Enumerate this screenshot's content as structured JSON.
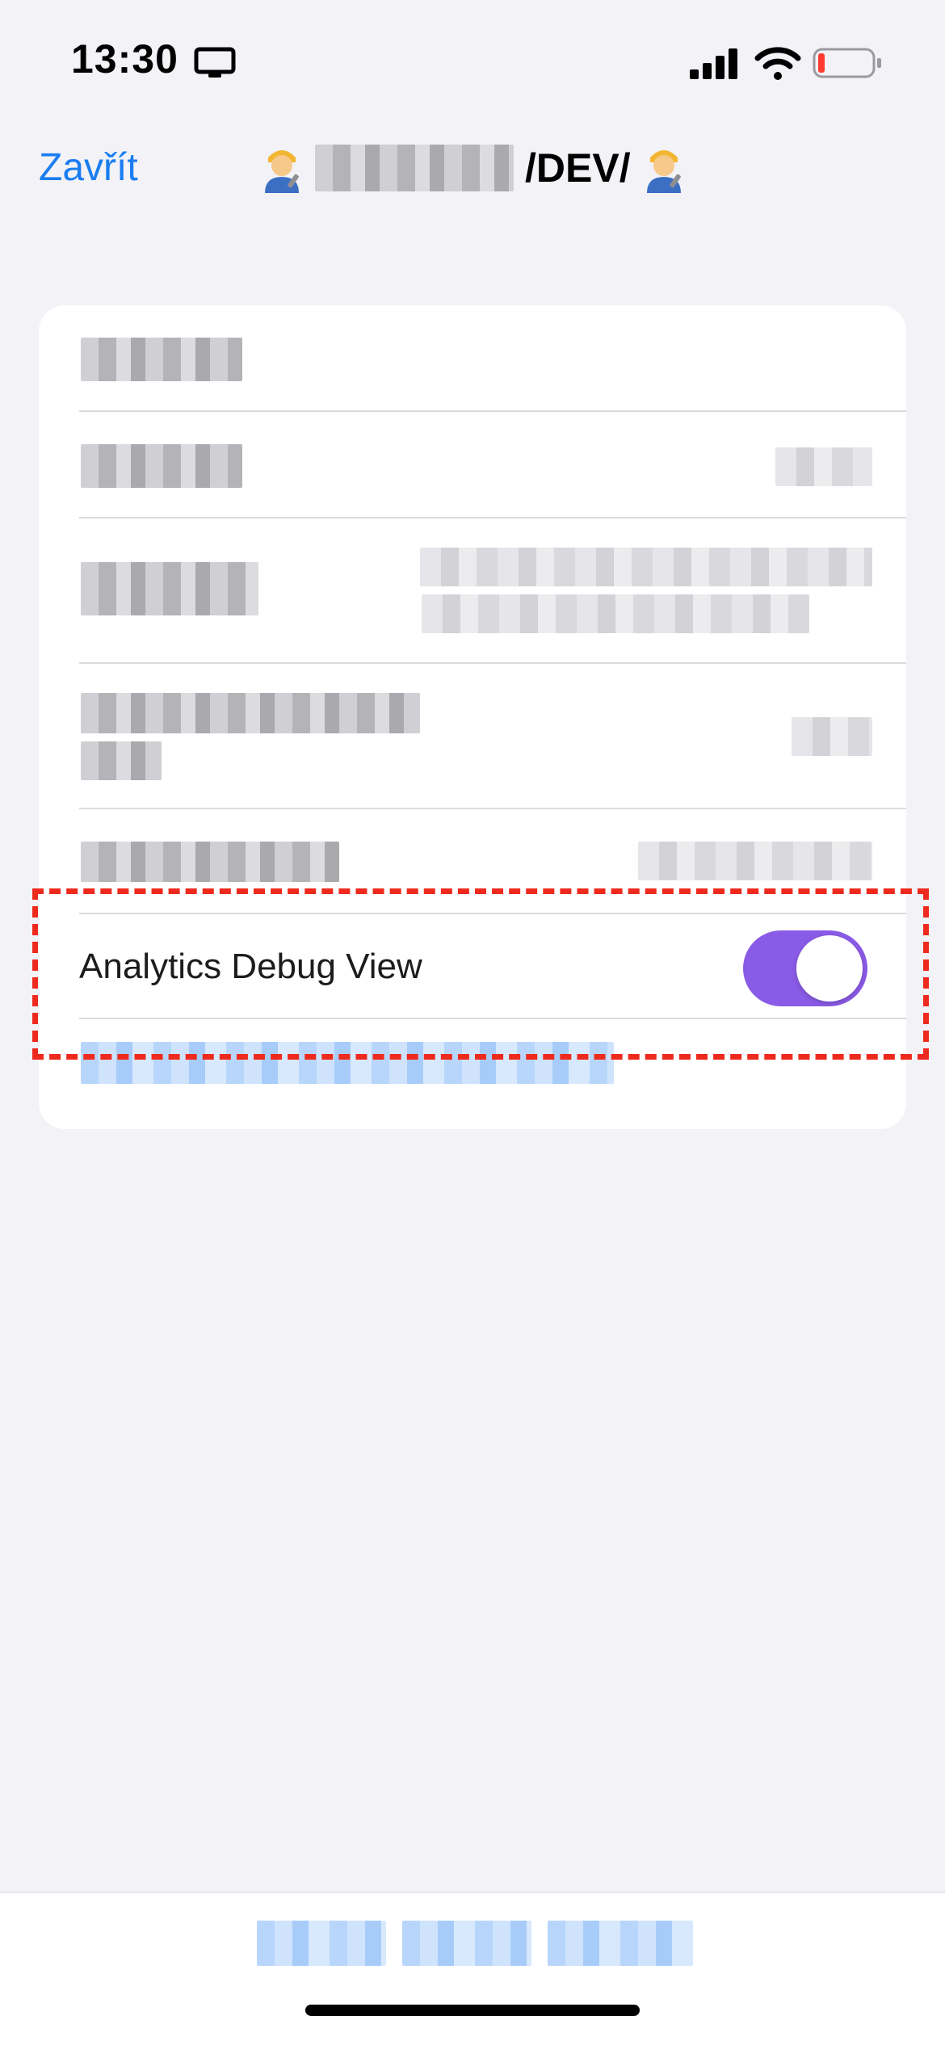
{
  "status_bar": {
    "time": "13:30",
    "icons": [
      "screen-mirror-icon",
      "signal-icon",
      "wifi-icon",
      "battery-icon"
    ],
    "battery_color": "#ff3b30"
  },
  "nav": {
    "close_label": "Zavřít",
    "title_suffix": "/DEV/",
    "title_icon": "mechanic-emoji-icon"
  },
  "settings": {
    "toggle_label": "Analytics Debug View",
    "toggle_state": "on",
    "toggle_color": "#8a5be6"
  },
  "annotation": {
    "color": "#ee2a1e",
    "style": "dashed"
  },
  "colors": {
    "link": "#1a7df0",
    "background": "#f2f2f7"
  }
}
